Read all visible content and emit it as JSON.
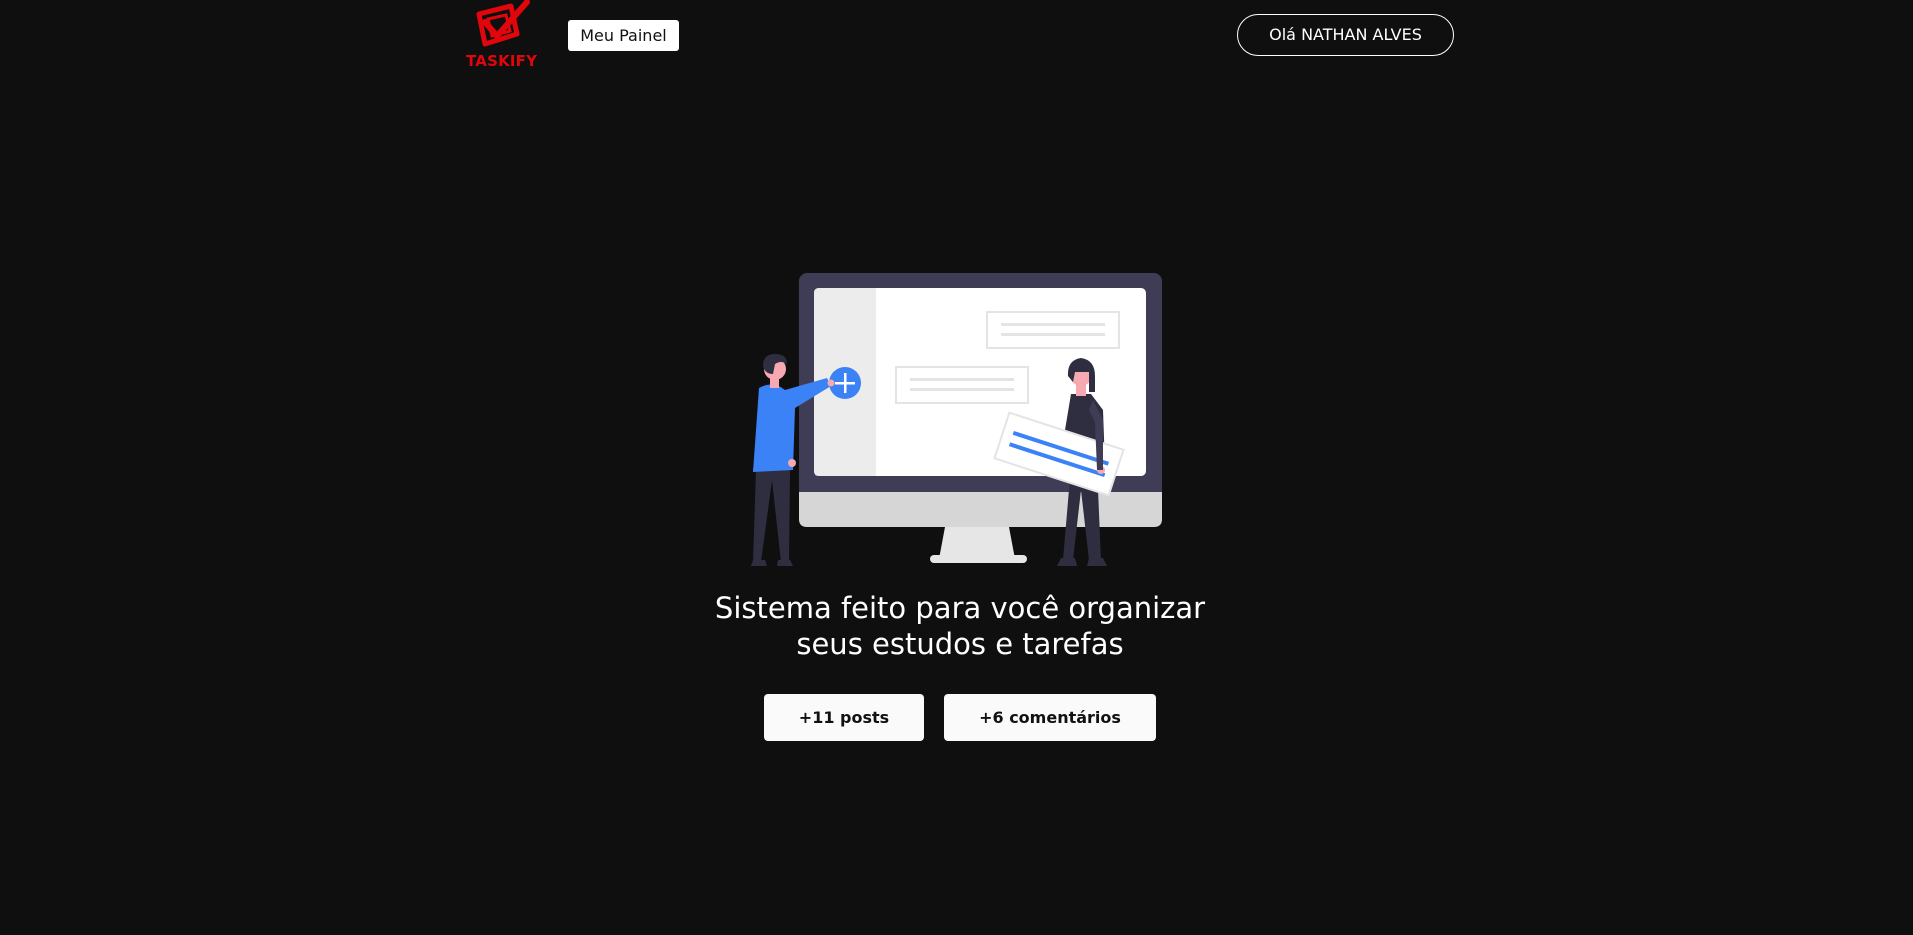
{
  "header": {
    "logo_text": "TASKIFY",
    "panel_button_label": "Meu Painel",
    "user_button_label": "Olá NATHAN ALVES"
  },
  "hero": {
    "title_line1": "Sistema feito para você organizar",
    "title_line2": "seus estudos e tarefas",
    "illustration": "task-board-illustration"
  },
  "stats": {
    "posts_label": "+11 posts",
    "comments_label": "+6 comentários"
  },
  "colors": {
    "background": "#0f0f0f",
    "brand_red": "#e0060b",
    "accent_blue": "#3b82f6",
    "white": "#ffffff"
  }
}
